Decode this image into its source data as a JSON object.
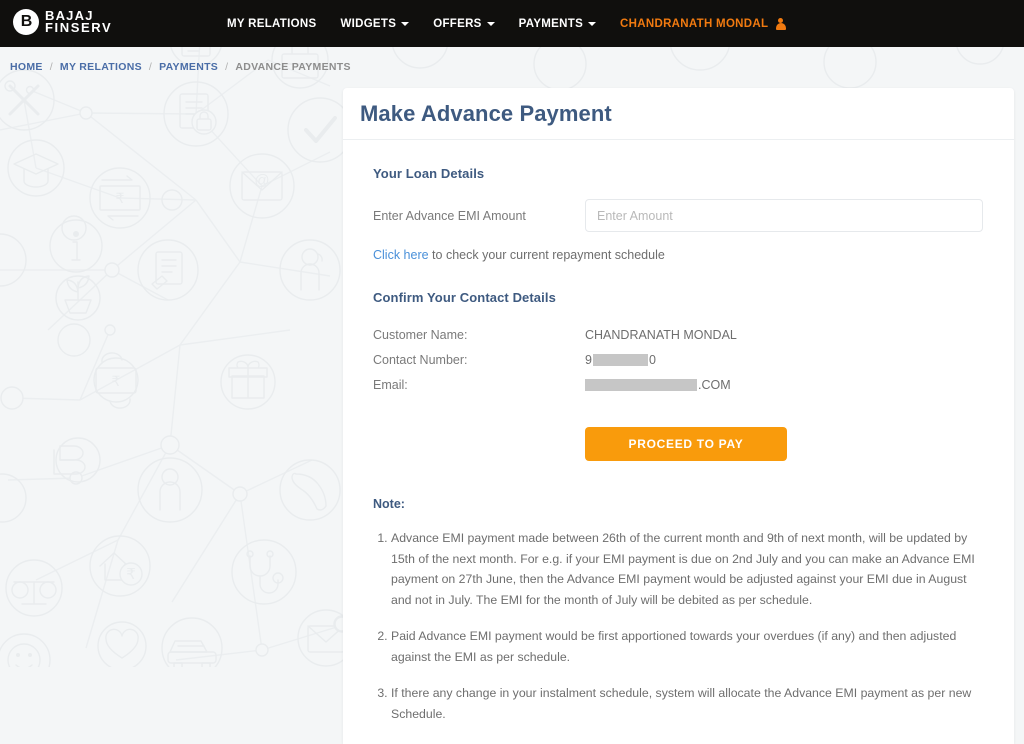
{
  "nav": {
    "logo": {
      "mark": "Ⓑ",
      "line1": "BAJAJ",
      "line2": "FINSERV"
    },
    "items": [
      {
        "label": "MY RELATIONS",
        "caret": false,
        "user": false
      },
      {
        "label": "WIDGETS",
        "caret": true,
        "user": false
      },
      {
        "label": "OFFERS",
        "caret": true,
        "user": false
      },
      {
        "label": "PAYMENTS",
        "caret": true,
        "user": false
      },
      {
        "label": "CHANDRANATH MONDAL",
        "caret": false,
        "user": true
      }
    ]
  },
  "breadcrumb": {
    "separator": "/",
    "items": [
      {
        "label": "HOME",
        "current": false
      },
      {
        "label": "MY RELATIONS",
        "current": false
      },
      {
        "label": "PAYMENTS",
        "current": false
      },
      {
        "label": "ADVANCE PAYMENTS",
        "current": true
      }
    ]
  },
  "card": {
    "title": "Make Advance Payment",
    "loan_section": {
      "heading": "Your Loan Details",
      "amount_label": "Enter Advance EMI Amount",
      "amount_value": "",
      "amount_placeholder": "Enter Amount",
      "schedule_link": "Click here",
      "schedule_text": " to check your current repayment schedule"
    },
    "contact_section": {
      "heading": "Confirm Your Contact Details",
      "rows": [
        {
          "label": "Customer Name:",
          "value": "CHANDRANATH MONDAL",
          "redacted": false
        },
        {
          "label": "Contact Number:",
          "value_prefix": "9",
          "value_suffix": "0",
          "redacted": true
        },
        {
          "label": "Email:",
          "value_prefix": "",
          "value_suffix": ".COM",
          "redacted": true
        }
      ]
    },
    "pay_button": "PROCEED TO PAY",
    "notes": {
      "heading": "Note:",
      "items": [
        "Advance EMI payment made between 26th of the current month and 9th of next month, will be updated by 15th of the next month. For e.g. if your EMI payment is due on 2nd July and you can make an Advance EMI payment on 27th June, then the Advance EMI payment would be adjusted against your EMI due in August and not in July. The EMI for the month of July will be debited as per schedule.",
        "Paid Advance EMI payment would be first apportioned towards your overdues (if any) and then adjusted against the EMI as per schedule.",
        "If there any change in your instalment schedule, system will allocate the Advance EMI payment as per new Schedule."
      ]
    }
  },
  "colors": {
    "nav_background": "#100f0d",
    "accent_orange": "#f99b0c",
    "user_orange": "#f17a10",
    "heading_blue": "#3e5a80",
    "link_blue": "#4a90d9",
    "crumb_blue": "#4a6da7",
    "page_background": "#f4f6f7"
  }
}
